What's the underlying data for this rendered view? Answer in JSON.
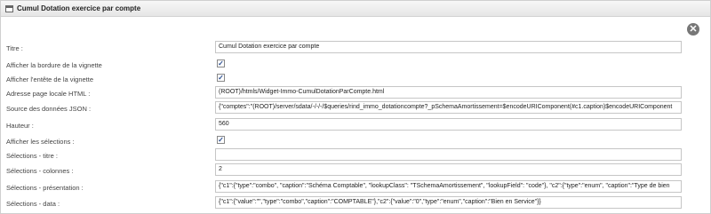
{
  "window": {
    "title": "Cumul Dotation exercice par compte"
  },
  "close_glyph": "✕",
  "check_glyph": "✓",
  "rows": [
    {
      "label": "Titre :",
      "type": "text",
      "value": "Cumul Dotation exercice par compte"
    },
    {
      "label": "Afficher la bordure de la vignette",
      "type": "checkbox",
      "checked": true
    },
    {
      "label": "Afficher l'entête de la vignette",
      "type": "checkbox",
      "checked": true
    },
    {
      "label": "Adresse page locale HTML :",
      "type": "text",
      "value": "(ROOT)/htmls/Widget-Immo-CumulDotationParCompte.html"
    },
    {
      "label": "Source des données JSON :",
      "type": "text",
      "value": "{\"comptes\":\"(ROOT)/server/sdata/-/-/-/$queries/rind_immo_dotationcompte?_pSchemaAmortissement=$encodeURIComponent(#c1.caption)$encodeURIComponent"
    },
    {
      "label": "Hauteur :",
      "type": "text",
      "value": "560"
    },
    {
      "label": "Afficher les sélections :",
      "type": "checkbox",
      "checked": true
    },
    {
      "label": "Sélections - titre :",
      "type": "text",
      "value": ""
    },
    {
      "label": "Sélections - colonnes :",
      "type": "text",
      "value": "2"
    },
    {
      "label": "Sélections - présentation :",
      "type": "text",
      "value": "{\"c1\":{\"type\":\"combo\", \"caption\":\"Schéma Comptable\", \"lookupClass\": \"TSchemaAmortissement\", \"lookupField\": \"code\"}, \"c2\":{\"type\":\"enum\", \"caption\":\"Type de bien"
    },
    {
      "label": "Sélections - data :",
      "type": "text",
      "value": "{\"c1\":{\"value\":\"\",\"type\":\"combo\",\"caption\":\"COMPTABLE\"},\"c2\":{\"value\":\"0\",\"type\":\"enum\",\"caption\":\"Bien en Service\"}}"
    }
  ]
}
